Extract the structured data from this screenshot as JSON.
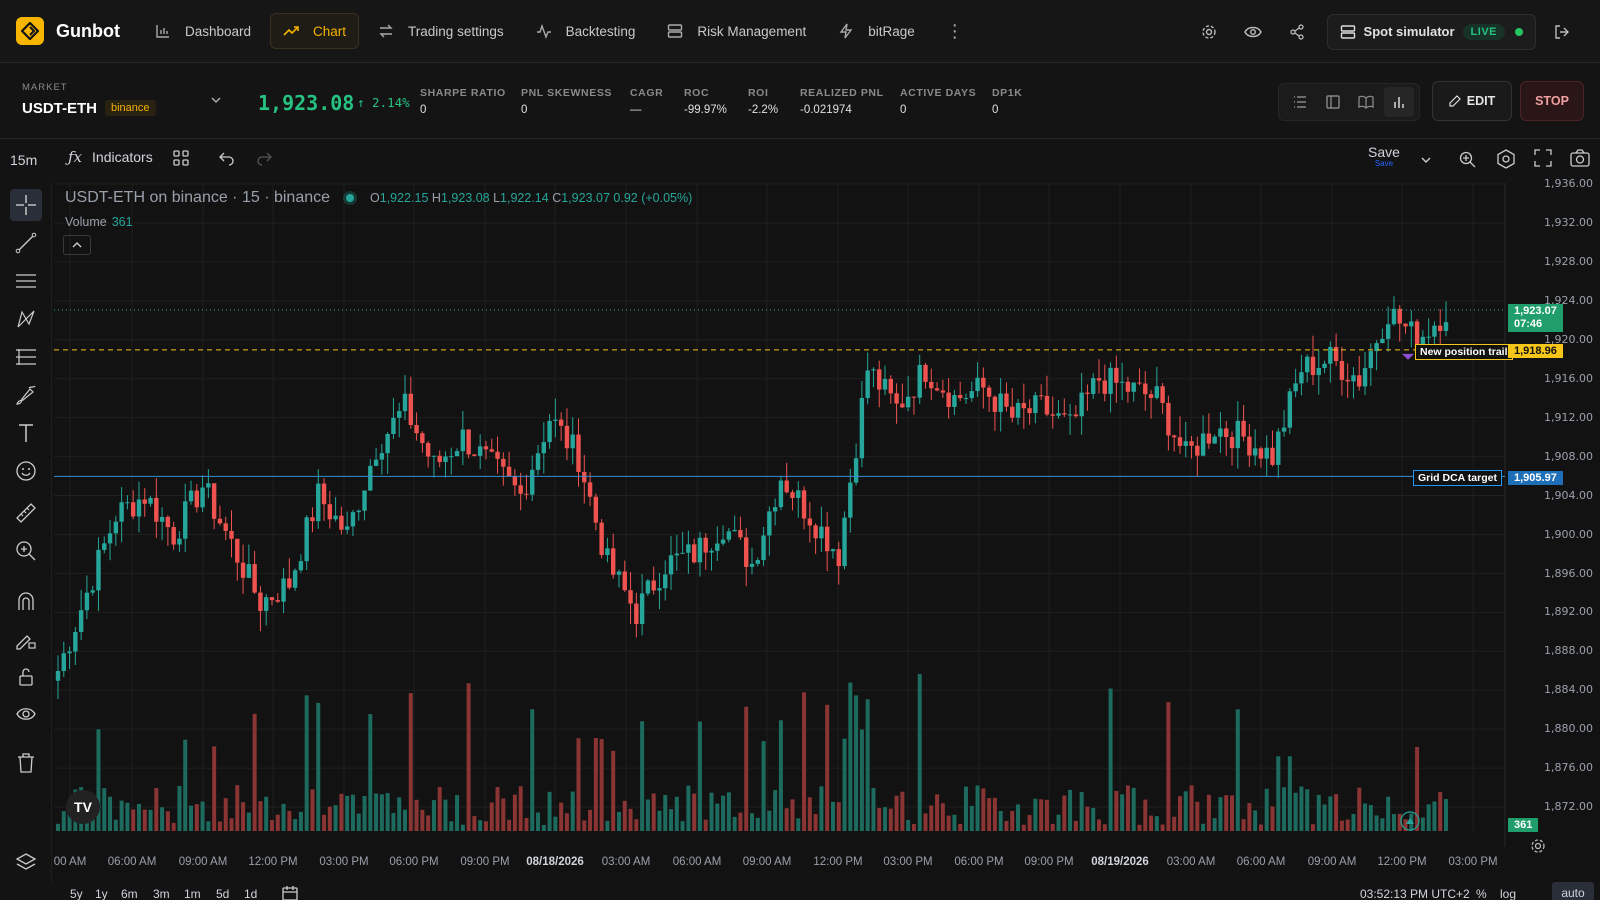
{
  "app": {
    "name": "Gunbot",
    "nav": [
      {
        "label": "Dashboard",
        "icon": "bar-chart-icon"
      },
      {
        "label": "Chart",
        "icon": "trend-up-icon",
        "active": true
      },
      {
        "label": "Trading settings",
        "icon": "arrows-icon"
      },
      {
        "label": "Backtesting",
        "icon": "pulse-icon"
      },
      {
        "label": "Risk Management",
        "icon": "server-icon"
      },
      {
        "label": "bitRage",
        "icon": "bolt-icon"
      }
    ],
    "mode_label": "Spot simulator",
    "live_badge": "LIVE"
  },
  "market": {
    "label": "MARKET",
    "pair": "USDT-ETH",
    "exchange": "binance",
    "price": "1,923.08",
    "change": "↑ 2.14%",
    "stats": [
      {
        "key": "SHARPE RATIO",
        "value": "0"
      },
      {
        "key": "PNL SKEWNESS",
        "value": "0"
      },
      {
        "key": "CAGR",
        "value": "—"
      },
      {
        "key": "ROC",
        "value": "-99.97%"
      },
      {
        "key": "ROI",
        "value": "-2.2%"
      },
      {
        "key": "REALIZED PNL",
        "value": "-0.021974"
      },
      {
        "key": "ACTIVE DAYS",
        "value": "0"
      },
      {
        "key": "DP1K",
        "value": "0"
      }
    ],
    "edit_label": "EDIT",
    "stop_label": "STOP"
  },
  "toolbar": {
    "timeframe": "15m",
    "indicators_label": "Indicators",
    "save_label": "Save",
    "save_sub": "Save"
  },
  "chart_legend": {
    "title": "USDT-ETH on binance · 15 · binance",
    "o_label": "O",
    "o": "1,922.15",
    "h_label": "H",
    "h": "1,923.08",
    "l_label": "L",
    "l": "1,922.14",
    "c_label": "C",
    "c": "1,923.07",
    "chg": "0.92 (+0.05%)",
    "volume_label": "Volume",
    "volume_value": "361"
  },
  "price_axis": [
    "1,936.00",
    "1,932.00",
    "1,928.00",
    "1,924.00",
    "1,920.00",
    "1,916.00",
    "1,912.00",
    "1,908.00",
    "1,904.00",
    "1,900.00",
    "1,896.00",
    "1,892.00",
    "1,888.00",
    "1,884.00",
    "1,880.00",
    "1,876.00",
    "1,872.00"
  ],
  "price_tags": {
    "last_price": "1,923.07",
    "countdown": "07:46",
    "trail_price": "1,918.96",
    "trail_label": "New position trail",
    "dca_price": "1,905.97",
    "dca_label": "Grid DCA target",
    "volume_tag": "361"
  },
  "time_axis": [
    {
      "label": "00 AM"
    },
    {
      "label": "06:00 AM"
    },
    {
      "label": "09:00 AM"
    },
    {
      "label": "12:00 PM"
    },
    {
      "label": "03:00 PM"
    },
    {
      "label": "06:00 PM"
    },
    {
      "label": "09:00 PM"
    },
    {
      "label": "08/18/2026",
      "bold": true
    },
    {
      "label": "03:00 AM"
    },
    {
      "label": "06:00 AM"
    },
    {
      "label": "09:00 AM"
    },
    {
      "label": "12:00 PM"
    },
    {
      "label": "03:00 PM"
    },
    {
      "label": "06:00 PM"
    },
    {
      "label": "09:00 PM"
    },
    {
      "label": "08/19/2026",
      "bold": true
    },
    {
      "label": "03:00 AM"
    },
    {
      "label": "06:00 AM"
    },
    {
      "label": "09:00 AM"
    },
    {
      "label": "12:00 PM"
    },
    {
      "label": "03:00 PM"
    }
  ],
  "bottom": {
    "ranges": [
      "5y",
      "1y",
      "6m",
      "3m",
      "1m",
      "5d",
      "1d"
    ],
    "clock": "03:52:13 PM UTC+2",
    "percent": "%",
    "log": "log",
    "auto": "auto"
  },
  "colors": {
    "up": "#26a69a",
    "down": "#ef5350",
    "accent": "#f5b400",
    "trail": "#f5c518",
    "dca": "#2196f3"
  },
  "chart_data": {
    "type": "candlestick",
    "pair": "USDT-ETH",
    "interval": "15",
    "ylim": [
      1870,
      1937
    ],
    "anchors": [
      [
        0,
        1886
      ],
      [
        5,
        1894
      ],
      [
        10,
        1902
      ],
      [
        15,
        1904
      ],
      [
        20,
        1900
      ],
      [
        25,
        1905
      ],
      [
        30,
        1899
      ],
      [
        35,
        1893
      ],
      [
        40,
        1895
      ],
      [
        45,
        1904
      ],
      [
        50,
        1900
      ],
      [
        55,
        1909
      ],
      [
        60,
        1913
      ],
      [
        65,
        1907
      ],
      [
        70,
        1910
      ],
      [
        75,
        1907
      ],
      [
        80,
        1904
      ],
      [
        85,
        1912
      ],
      [
        90,
        1908
      ],
      [
        95,
        1897
      ],
      [
        100,
        1892
      ],
      [
        105,
        1897
      ],
      [
        110,
        1898
      ],
      [
        115,
        1901
      ],
      [
        120,
        1897
      ],
      [
        125,
        1906
      ],
      [
        130,
        1902
      ],
      [
        135,
        1898
      ],
      [
        140,
        1917
      ],
      [
        145,
        1913
      ],
      [
        150,
        1917
      ],
      [
        155,
        1914
      ],
      [
        160,
        1915
      ],
      [
        165,
        1912
      ],
      [
        170,
        1913
      ],
      [
        175,
        1911
      ],
      [
        180,
        1916
      ],
      [
        185,
        1915
      ],
      [
        190,
        1914
      ],
      [
        195,
        1908
      ],
      [
        200,
        1911
      ],
      [
        205,
        1910
      ],
      [
        210,
        1908
      ],
      [
        215,
        1917
      ],
      [
        220,
        1918
      ],
      [
        225,
        1916
      ],
      [
        230,
        1923
      ],
      [
        235,
        1920
      ],
      [
        240,
        1923
      ]
    ],
    "volume_peak": "361"
  }
}
